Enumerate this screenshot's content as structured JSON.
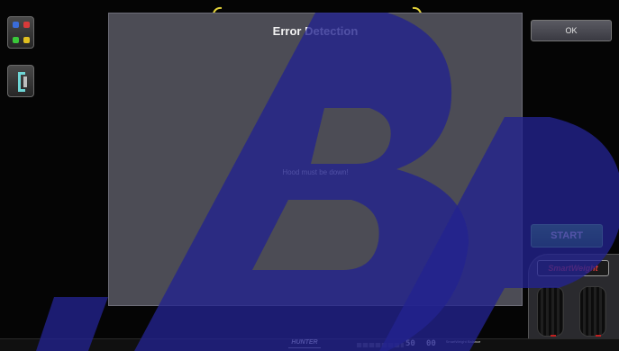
{
  "dialog": {
    "title": "Error Detection",
    "message": "Hood must be down!"
  },
  "buttons": {
    "ok_label": "OK",
    "start_label": "START"
  },
  "smartweight": {
    "logo_text": "SmartWeight"
  },
  "status_bar": {
    "brand": "HUNTER",
    "readout_a": "50",
    "readout_b": "00",
    "label": "SmartWeight Balance"
  },
  "colors": {
    "dialog_bg": "#4c4c55",
    "start_green": "#2f9a2f",
    "watermark_blue": "#232390",
    "brand_red": "#e03a3a"
  },
  "icons": [
    "display-settings-icon",
    "clip-weight-icon",
    "wheel-outline-icon"
  ]
}
